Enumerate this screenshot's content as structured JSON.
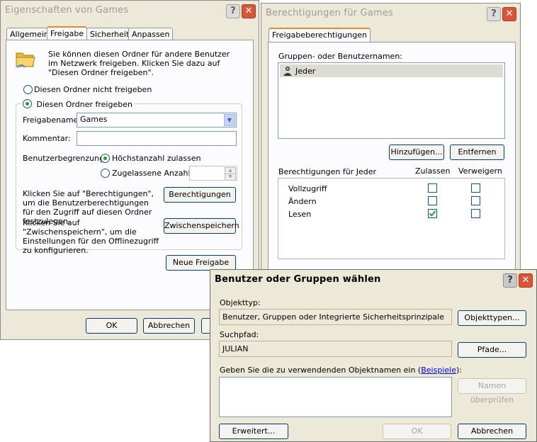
{
  "win1": {
    "title": "Eigenschaften von Games",
    "tabs": [
      "Allgemein",
      "Freigabe",
      "Sicherheit",
      "Anpassen"
    ],
    "info": "Sie können diesen Ordner für andere Benutzer im Netzwerk freigeben. Klicken Sie dazu auf \"Diesen Ordner freigeben\".",
    "radio_no_share": "Diesen Ordner nicht freigeben",
    "radio_share": "Diesen Ordner freigeben",
    "share_name_label": "Freigabename:",
    "share_name_value": "Games",
    "comment_label": "Kommentar:",
    "comment_value": "",
    "user_limit_label": "Benutzerbegrenzung:",
    "max_allowed": "Höchstanzahl zulassen",
    "allowed_count": "Zugelassene Anzahl:",
    "perm_text": "Klicken Sie auf \"Berechtigungen\", um die Benutzerberechtigungen für den Zugriff auf diesen Ordner festzulegen.",
    "perm_button": "Berechtigungen",
    "cache_text": "Klicken Sie auf \"Zwischenspeichern\", um die Einstellungen für den Offlinezugriff zu konfigurieren.",
    "cache_button": "Zwischenspeichern",
    "new_share_button": "Neue Freigabe",
    "ok": "OK",
    "cancel": "Abbrechen"
  },
  "win2": {
    "title": "Berechtigungen für Games",
    "tab": "Freigabeberechtigungen",
    "names_label": "Gruppen- oder Benutzernamen:",
    "users": [
      "Jeder"
    ],
    "add_button": "Hinzufügen...",
    "remove_button": "Entfernen",
    "perm_header": "Berechtigungen für Jeder",
    "allow_header": "Zulassen",
    "deny_header": "Verweigern",
    "permissions": [
      {
        "name": "Vollzugriff",
        "allow": false,
        "deny": false
      },
      {
        "name": "Ändern",
        "allow": false,
        "deny": false
      },
      {
        "name": "Lesen",
        "allow": true,
        "deny": false
      }
    ]
  },
  "win3": {
    "title": "Benutzer oder Gruppen wählen",
    "object_type_label": "Objekttyp:",
    "object_type_value": "Benutzer, Gruppen oder Integrierte Sicherheitsprinzipale",
    "object_types_button": "Objekttypen...",
    "search_path_label": "Suchpfad:",
    "search_path_value": "JULIAN",
    "paths_button": "Pfade...",
    "enter_names_label_pre": "Geben Sie die zu verwendenden Objektnamen ein (",
    "examples_link": "Beispiele",
    "enter_names_label_post": "):",
    "check_names_button": "Namen überprüfen",
    "advanced_button": "Erweitert...",
    "ok": "OK",
    "cancel": "Abbrechen"
  }
}
